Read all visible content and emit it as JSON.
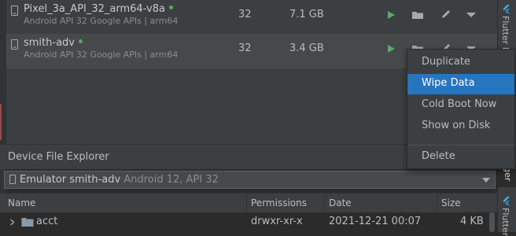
{
  "avd_list": {
    "rows": [
      {
        "name": "Pixel_3a_API_32_arm64-v8a",
        "subtitle": "Android API 32 Google APIs | arm64",
        "api": "32",
        "size": "7.1 GB",
        "online": true,
        "icons": [
          "device-phone-icon",
          "play-icon",
          "folder-icon",
          "pencil-icon",
          "chevron-down-icon"
        ]
      },
      {
        "name": "smith-adv",
        "subtitle": "Android API 32 Google APIs | arm64",
        "api": "32",
        "size": "3.4 GB",
        "online": true,
        "icons": [
          "device-phone-icon",
          "play-icon",
          "folder-icon",
          "pencil-icon",
          "chevron-down-icon"
        ]
      }
    ]
  },
  "right_strip": {
    "top_label": "Flutter Pe",
    "middle_label": "ger",
    "bottom_label": "Flutter",
    "icons": [
      "flutter-icon"
    ]
  },
  "context_menu": {
    "items": [
      "Duplicate",
      "Wipe Data",
      "Cold Boot Now",
      "Show on Disk",
      "Delete"
    ],
    "selected": "Wipe Data"
  },
  "device_file_explorer": {
    "title": "Device File Explorer",
    "device_selector": {
      "name": "Emulator smith-adv",
      "detail": "Android 12, API 32"
    },
    "columns": [
      "Name",
      "Permissions",
      "Date",
      "Size"
    ],
    "rows": [
      {
        "name": "acct",
        "permissions": "drwxr-xr-x",
        "date": "2021-12-21 00:07",
        "size": "4 KB"
      }
    ]
  },
  "colors": {
    "accent_selection": "#2675bf",
    "run_green": "#59a869",
    "panel_bg": "#3c3f41",
    "editor_bg": "#2b2b2b"
  }
}
